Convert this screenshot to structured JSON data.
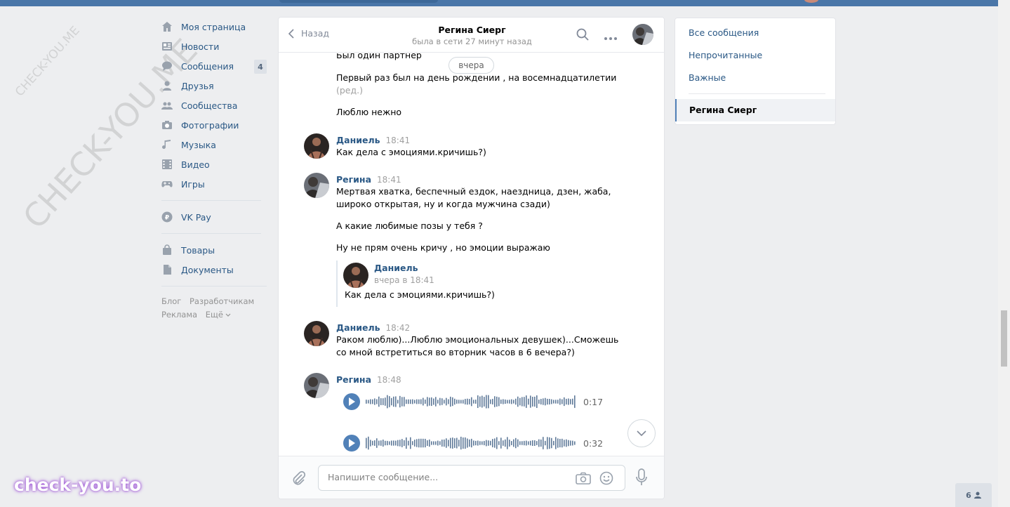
{
  "watermark": {
    "small": "CHECK-YOU.ME",
    "large": "CHECK-YOU.ME",
    "brand": "check-you.to"
  },
  "nav": {
    "items": [
      {
        "label": "Моя страница",
        "icon": "home-icon"
      },
      {
        "label": "Новости",
        "icon": "news-icon"
      },
      {
        "label": "Сообщения",
        "icon": "messages-icon",
        "badge": "4"
      },
      {
        "label": "Друзья",
        "icon": "friends-icon"
      },
      {
        "label": "Сообщества",
        "icon": "groups-icon"
      },
      {
        "label": "Фотографии",
        "icon": "camera-icon"
      },
      {
        "label": "Музыка",
        "icon": "music-icon"
      },
      {
        "label": "Видео",
        "icon": "video-icon"
      },
      {
        "label": "Игры",
        "icon": "gamepad-icon"
      }
    ],
    "vkpay": "VK Pay",
    "extra": [
      {
        "label": "Товары",
        "icon": "bag-icon"
      },
      {
        "label": "Документы",
        "icon": "document-icon"
      }
    ],
    "footer": {
      "blog": "Блог",
      "developers": "Разработчикам",
      "ads": "Реклама",
      "more": "Ещё"
    }
  },
  "chat": {
    "back_label": "Назад",
    "peer_name": "Регина Сиерг",
    "peer_status": "была в сети 27 минут назад",
    "date_pill": "вчера",
    "m1": "Был один партнёр",
    "m2": "Первый раз был на день рождении , на восемнадцатилетии",
    "m2_edited": "(ред.)",
    "m3": "Люблю нежно",
    "g1": {
      "author": "Даниель",
      "time": "18:41",
      "text": "Как дела с эмоциями.кричишь?)"
    },
    "g2": {
      "author": "Регина",
      "time": "18:41",
      "line1": "Мертвая хватка, беспечный ездок, наездница, дзен, жаба,",
      "line2": "широко открытая, ну и когда мужчина сзади)",
      "text2": "А какие любимые позы у тебя ?",
      "text3": "Ну не прям очень кричу , но эмоции выражаю"
    },
    "forward": {
      "author": "Даниель",
      "date": "вчера в 18:41",
      "text": "Как дела с эмоциями.кричишь?)"
    },
    "g3": {
      "author": "Даниель",
      "time": "18:42",
      "line1": "Раком люблю)...Люблю эмоциональных девушек)...Сможешь",
      "line2": "со мной встретиться во вторник часов в 6 вечера?)"
    },
    "g4": {
      "author": "Регина",
      "time": "18:48"
    },
    "audio1": {
      "duration": "0:17"
    },
    "audio2": {
      "duration": "0:32"
    },
    "input_placeholder": "Напишите сообщение..."
  },
  "right": {
    "all": "Все сообщения",
    "unread": "Непрочитанные",
    "important": "Важные",
    "active": "Регина Сиерг"
  },
  "online_count": "6",
  "colors": {
    "link": "#2a5885",
    "accent": "#5181b8",
    "header": "#4a76a8",
    "bg": "#edeef0"
  }
}
